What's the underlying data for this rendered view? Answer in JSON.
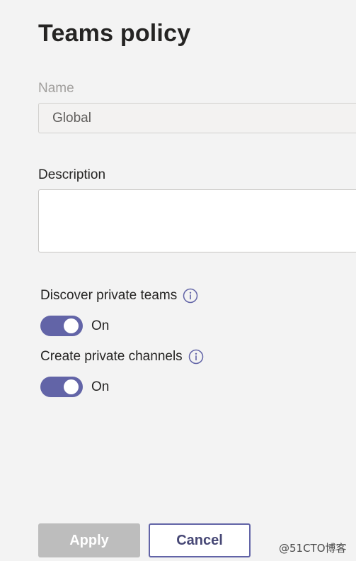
{
  "panel": {
    "title": "Teams policy"
  },
  "name_field": {
    "label": "Name",
    "value": "Global"
  },
  "description_field": {
    "label": "Description",
    "value": ""
  },
  "settings": [
    {
      "label": "Discover private teams",
      "icon": "info-icon",
      "state_text": "On",
      "enabled": true
    },
    {
      "label": "Create private channels",
      "icon": "info-icon",
      "state_text": "On",
      "enabled": true
    }
  ],
  "buttons": {
    "apply_label": "Apply",
    "cancel_label": "Cancel"
  },
  "watermark": "@51CTO博客",
  "colors": {
    "accent": "#6264a7",
    "disabled_button": "#bdbdbd",
    "background": "#f3f3f3"
  }
}
